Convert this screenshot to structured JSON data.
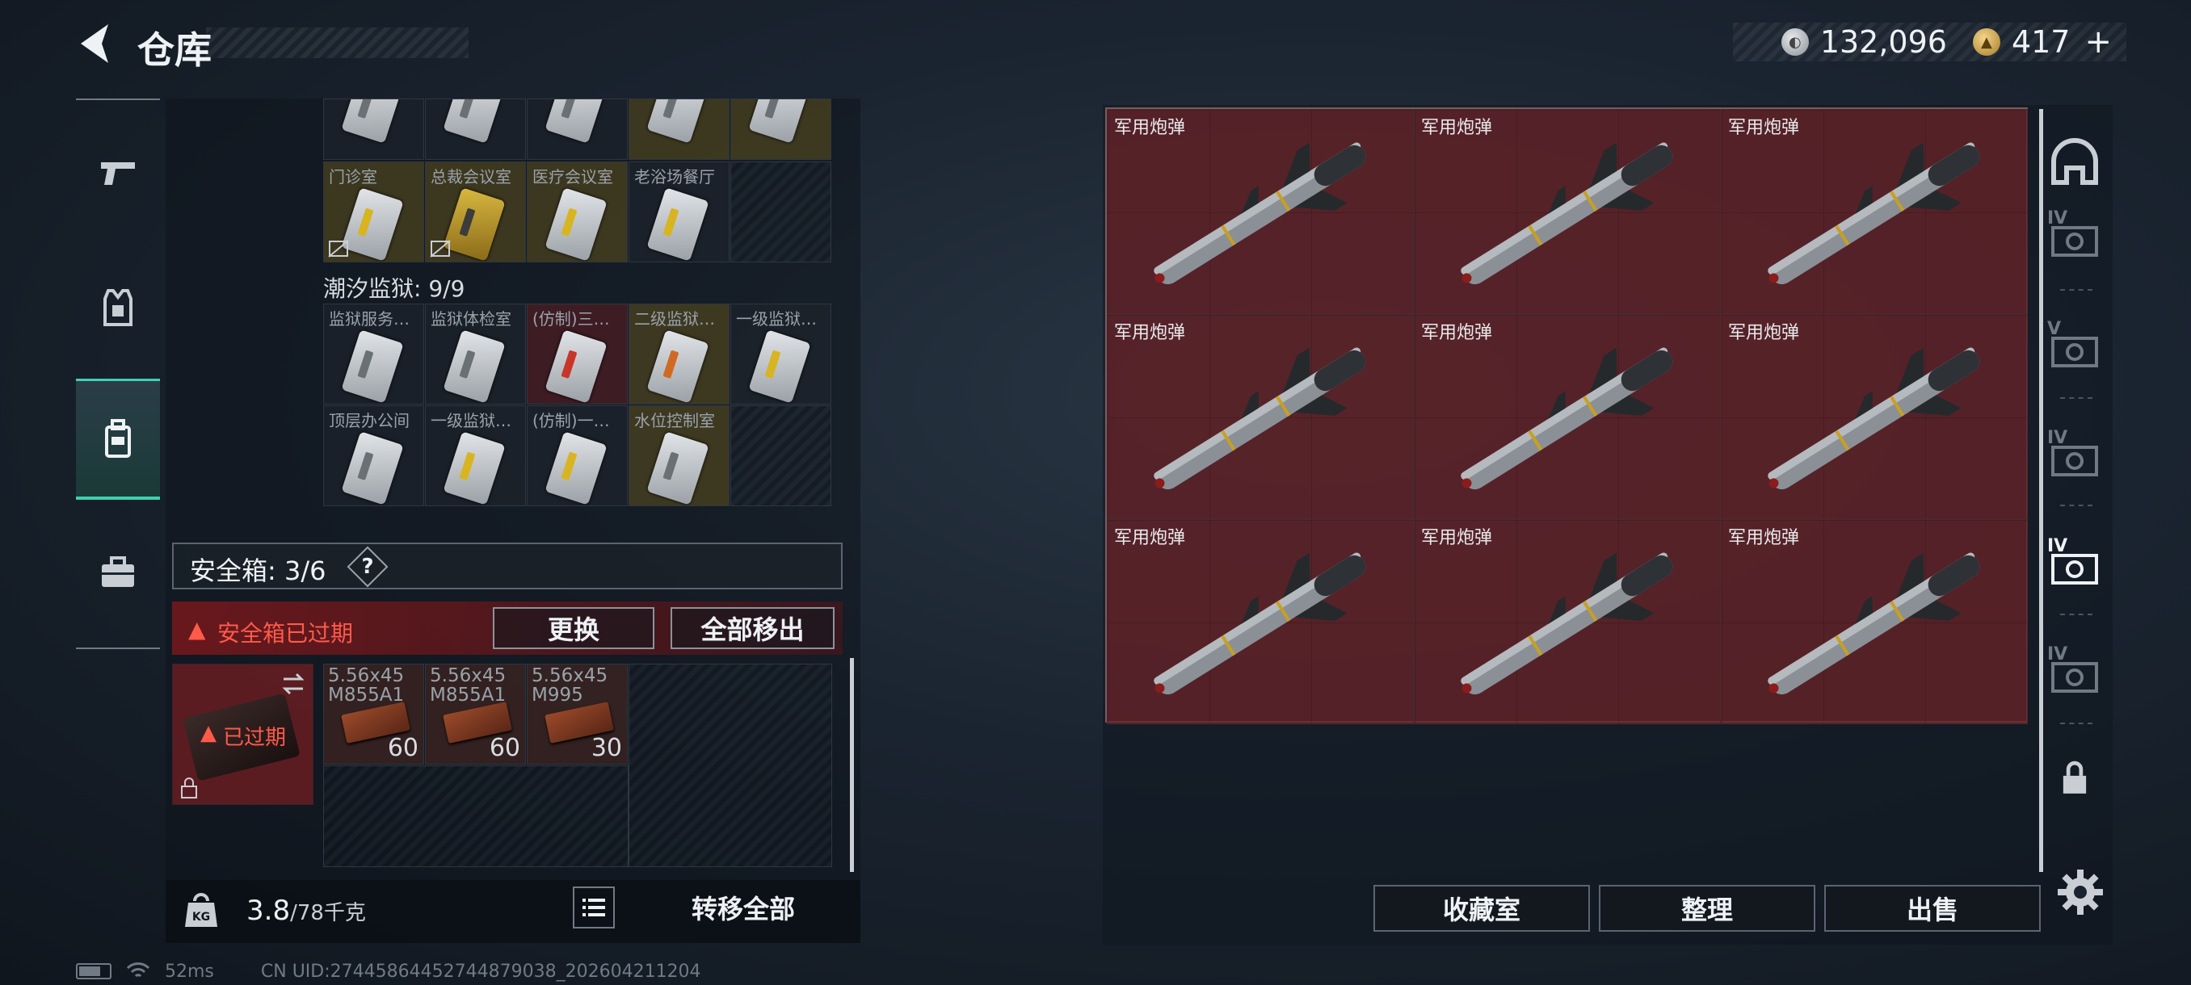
{
  "header": {
    "title": "仓库",
    "currency": [
      {
        "icon": "silver-coin-icon",
        "value": "132,096"
      },
      {
        "icon": "gold-coin-icon",
        "value": "417"
      }
    ],
    "plus": "+"
  },
  "leftnav": {
    "items": [
      {
        "name": "weapons",
        "icon": "gun-icon"
      },
      {
        "name": "armor",
        "icon": "vest-icon"
      },
      {
        "name": "backpack",
        "icon": "backpack-icon",
        "active": true
      },
      {
        "name": "toolbox",
        "icon": "briefcase-icon"
      }
    ]
  },
  "keys_row1": [
    "门诊室",
    "总裁会议室",
    "医疗会议室",
    "老浴场餐厅"
  ],
  "section": {
    "title": "潮汐监狱: 9/9"
  },
  "prison_keys": {
    "row1": [
      "监狱服务…",
      "监狱体检室",
      "(仿制)三…",
      "二级监狱…",
      "一级监狱…"
    ],
    "row2": [
      "顶层办公间",
      "一级监狱…",
      "(仿制)一…",
      "水位控制室"
    ]
  },
  "safebox": {
    "label": "安全箱: 3/6",
    "help": "?",
    "expired_warning": "安全箱已过期",
    "replace": "更换",
    "move_all": "全部移出",
    "badge": "已过期",
    "ammo": [
      {
        "label": "5.56x45\nM855A1",
        "count": "60"
      },
      {
        "label": "5.56x45\nM855A1",
        "count": "60"
      },
      {
        "label": "5.56x45\nM995",
        "count": "30"
      }
    ]
  },
  "weight": {
    "current": "3.8",
    "max": "/78千克",
    "transfer_all": "转移全部"
  },
  "stash": {
    "item_label": "军用炮弹",
    "count": 9
  },
  "rightbar": {
    "tiers": [
      "IV",
      "V",
      "IV",
      "IV",
      "IV"
    ]
  },
  "bottom_buttons": {
    "collection": "收藏室",
    "sort": "整理",
    "sell": "出售"
  },
  "status": {
    "ping": "52ms",
    "uid": "CN UID:274458644527448790​38_202604211204"
  }
}
